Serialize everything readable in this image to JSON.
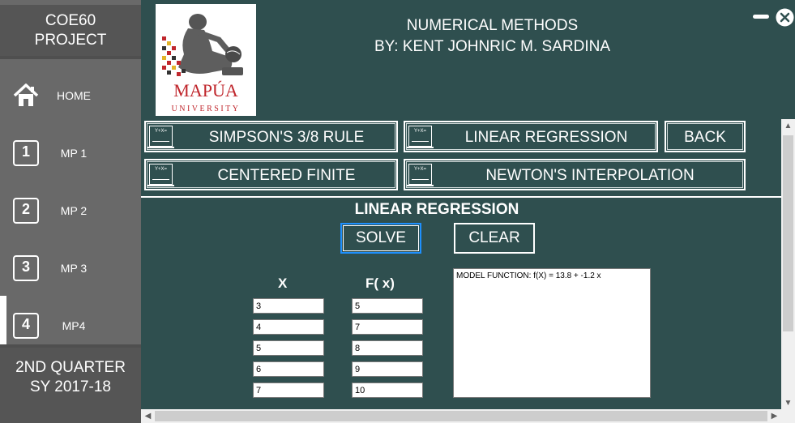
{
  "sidebar": {
    "title_line1": "COE60",
    "title_line2": "PROJECT",
    "items": [
      {
        "label": "HOME",
        "icon": "home-icon"
      },
      {
        "label": "MP 1",
        "icon_text": "1"
      },
      {
        "label": "MP 2",
        "icon_text": "2"
      },
      {
        "label": "MP 3",
        "icon_text": "3"
      },
      {
        "label": "MP4",
        "icon_text": "4"
      }
    ],
    "footer_line1": "2ND QUARTER",
    "footer_line2": "SY 2017-18"
  },
  "header": {
    "title_line1": "NUMERICAL METHODS",
    "title_line2": "BY: KENT JOHNRIC M. SARDINA",
    "logo_text": "MAPÚA",
    "logo_subtext": "UNIVERSITY"
  },
  "methods": {
    "simpson": "SIMPSON'S 3/8 RULE",
    "linear": "LINEAR REGRESSION",
    "back": "BACK",
    "centered": "CENTERED FINITE",
    "newton": "NEWTON'S INTERPOLATION",
    "icon_text": "Y+X="
  },
  "section": {
    "title": "LINEAR REGRESSION",
    "solve": "SOLVE",
    "clear": "CLEAR",
    "x_header": "X",
    "fx_header": "F( x)",
    "x_values": [
      "3",
      "4",
      "5",
      "6",
      "7"
    ],
    "fx_values": [
      "5",
      "7",
      "8",
      "9",
      "10"
    ],
    "output": "MODEL FUNCTION: f(X) = 13.8 + -1.2 x"
  },
  "colors": {
    "background": "#2f4f4f",
    "sidebar": "#696969",
    "sidebar_box": "#555555",
    "logo_red": "#c0272d"
  }
}
